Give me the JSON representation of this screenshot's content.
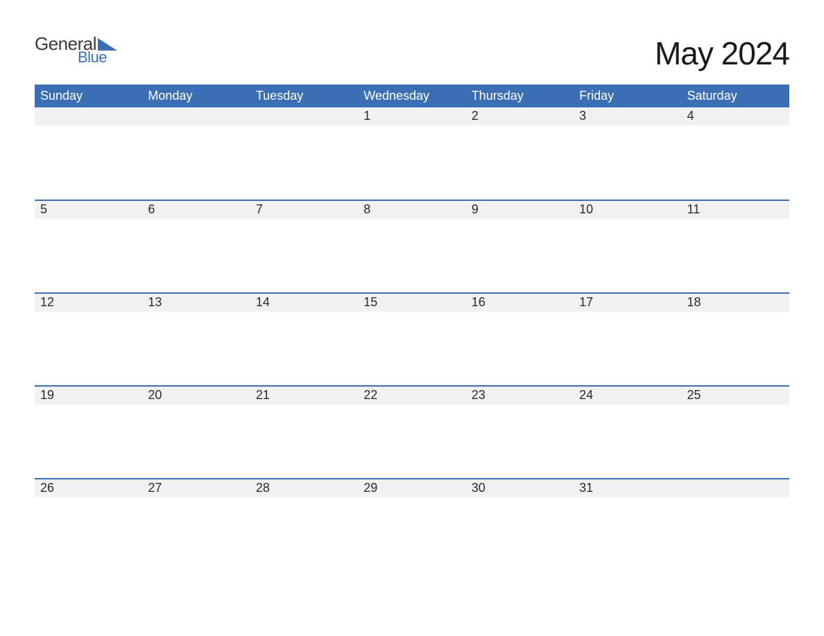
{
  "logo": {
    "text_top": "General",
    "text_bottom": "Blue"
  },
  "title": "May 2024",
  "day_headers": [
    "Sunday",
    "Monday",
    "Tuesday",
    "Wednesday",
    "Thursday",
    "Friday",
    "Saturday"
  ],
  "weeks": [
    [
      "",
      "",
      "",
      "1",
      "2",
      "3",
      "4"
    ],
    [
      "5",
      "6",
      "7",
      "8",
      "9",
      "10",
      "11"
    ],
    [
      "12",
      "13",
      "14",
      "15",
      "16",
      "17",
      "18"
    ],
    [
      "19",
      "20",
      "21",
      "22",
      "23",
      "24",
      "25"
    ],
    [
      "26",
      "27",
      "28",
      "29",
      "30",
      "31",
      ""
    ]
  ],
  "colors": {
    "header_bg": "#3b6fb5",
    "day_bg": "#f1f1f1"
  }
}
